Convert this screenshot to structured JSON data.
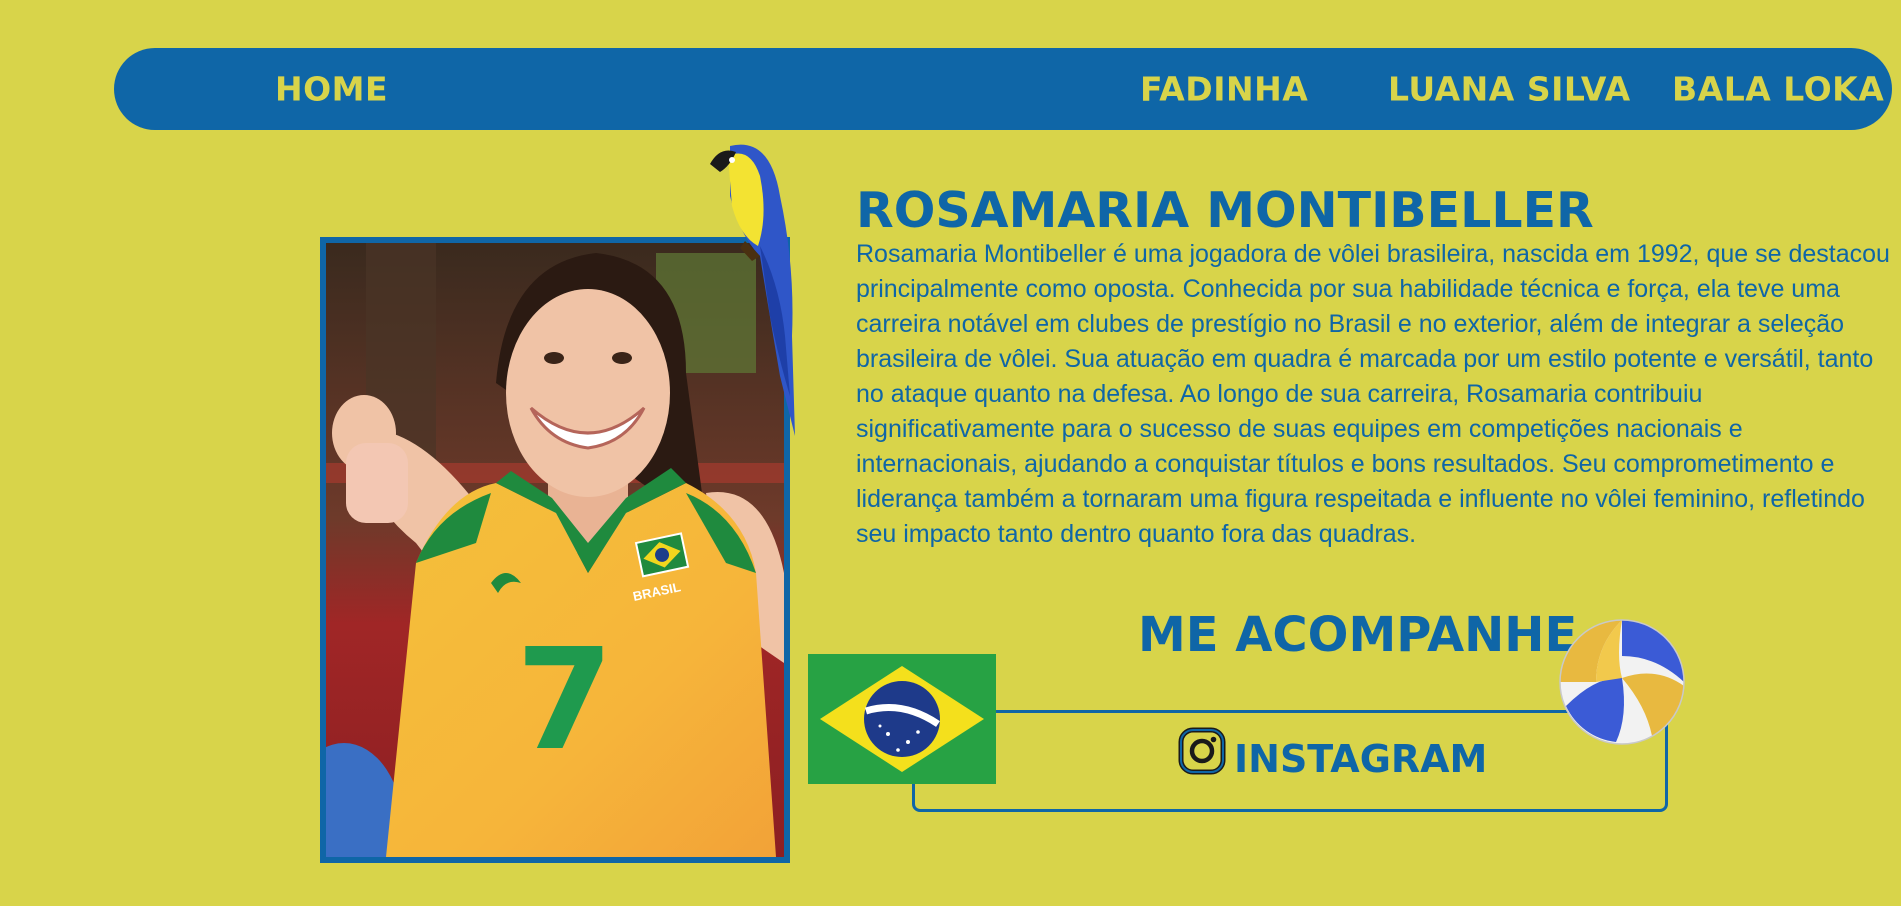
{
  "nav": {
    "home": "HOME",
    "fadinha": "FADINHA",
    "luana": "LUANA SILVA",
    "bala": "BALA LOKA"
  },
  "profile": {
    "name": "ROSAMARIA MONTIBELLER",
    "bio": "Rosamaria Montibeller é uma jogadora de vôlei brasileira, nascida em 1992, que se destacou principalmente como oposta. Conhecida por sua habilidade técnica e força, ela teve uma carreira notável em clubes de prestígio no Brasil e no exterior, além de integrar a seleção brasileira de vôlei. Sua atuação em quadra é marcada por um estilo potente e versátil, tanto no ataque quanto na defesa. Ao longo de sua carreira, Rosamaria contribuiu significativamente para o sucesso de suas equipes em competições nacionais e internacionais, ajudando a conquistar títulos e bons resultados. Seu comprometimento e liderança também a tornaram uma figura respeitada e influente no vôlei feminino, refletindo seu impacto tanto dentro quanto fora das quadras.",
    "jersey_number": "7",
    "jersey_text": "BRASIL"
  },
  "follow": {
    "heading": "ME ACOMPANHE",
    "instagram_label": "INSTAGRAM"
  },
  "colors": {
    "background": "#d8d44a",
    "primary_blue": "#0f66a7",
    "accent_yellow": "#d8d44a"
  },
  "icons": {
    "instagram": "instagram-icon",
    "parrot": "macaw-parrot",
    "flag": "brazil-flag",
    "ball": "volleyball"
  }
}
